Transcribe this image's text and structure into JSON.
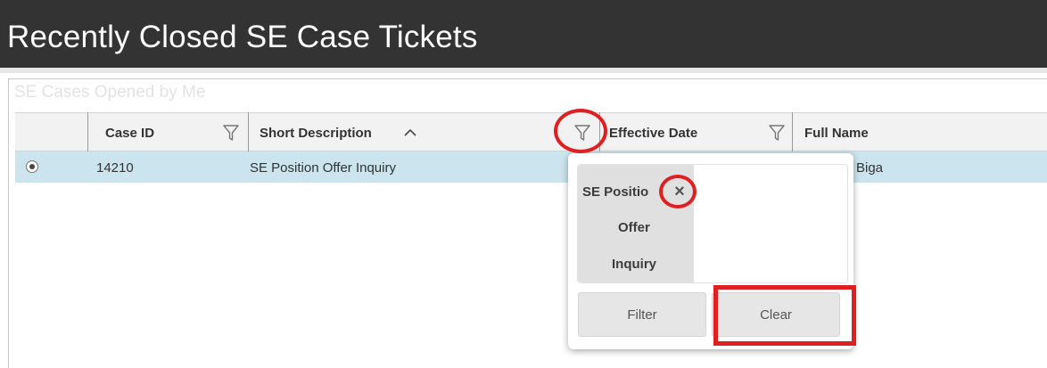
{
  "page": {
    "title": "Recently Closed SE Case Tickets"
  },
  "panel": {
    "title": "SE Cases Opened by Me"
  },
  "grid": {
    "columns": [
      {
        "label": "Case ID",
        "filterable": true
      },
      {
        "label": "Short Description",
        "sort": "ascending",
        "filterable": true
      },
      {
        "label": "Effective Date",
        "filterable": true
      },
      {
        "label": "Full Name"
      }
    ],
    "rows": [
      {
        "selected": true,
        "case_id": "14210",
        "short_description": "SE Position Offer Inquiry",
        "full_name_visible": "Biga"
      }
    ]
  },
  "filter_popup": {
    "chip_lines": [
      "SE Positio",
      "Offer",
      "Inquiry"
    ],
    "filter_label": "Filter",
    "clear_label": "Clear"
  },
  "icons": {
    "sort": "chevron-up-icon",
    "filter": "funnel-icon",
    "remove": "close-icon",
    "radio": "radio-selected-icon"
  },
  "colors": {
    "header_bg": "#333333",
    "row_selected": "#cce4ee",
    "annotation": "#e02020"
  }
}
